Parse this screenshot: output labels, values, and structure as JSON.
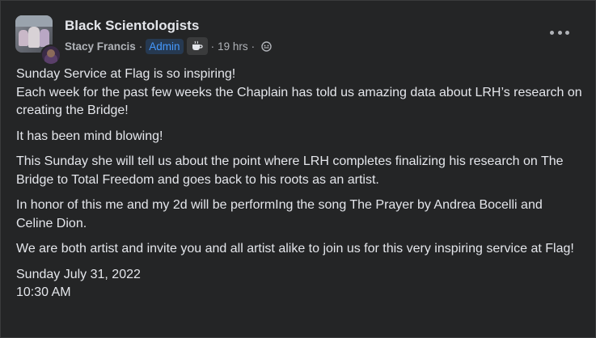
{
  "post": {
    "group_name": "Black Scientologists",
    "author": "Stacy Francis",
    "separator": "·",
    "role_badge": "Admin",
    "time": "19 hrs",
    "paragraphs": [
      "Sunday Service at Flag is so inspiring!\nEach week for the past few weeks the Chaplain has told us amazing data about LRH’s research on creating the Bridge!",
      "It has been mind blowing!",
      "This Sunday she will tell us about the point where LRH completes finalizing his research on The Bridge to Total Freedom and goes back to his roots as an artist.",
      "In honor of this me and my 2d will be performIng the song The Prayer by Andrea Bocelli and Celine Dion.",
      "We are both artist and invite you and all artist alike to join us for this very inspiring service at Flag!",
      "Sunday July 31, 2022\n10:30 AM"
    ]
  },
  "icons": {
    "coffee": "coffee-cup-icon",
    "audience": "globe-icon",
    "more": "more-options-icon"
  },
  "colors": {
    "background": "#242526",
    "text": "#e4e6eb",
    "secondary_text": "#b0b3b8",
    "admin_badge_bg": "#263951",
    "admin_badge_text": "#4599ff"
  }
}
